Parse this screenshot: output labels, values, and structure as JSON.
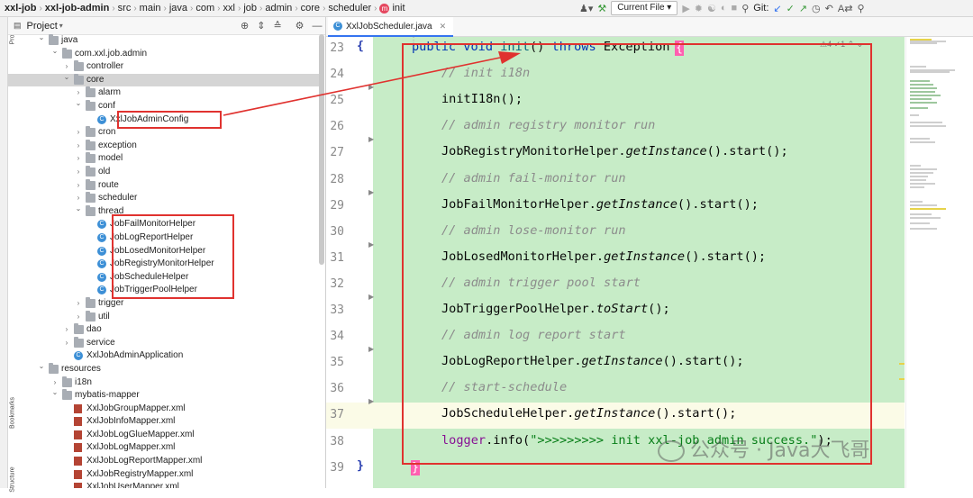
{
  "breadcrumbs": [
    "xxl-job",
    "xxl-job-admin",
    "src",
    "main",
    "java",
    "com",
    "xxl",
    "job",
    "admin",
    "core",
    "scheduler",
    "init"
  ],
  "toolbar": {
    "run_config": "Current File",
    "git_label": "Git:"
  },
  "stripe": {
    "project": "Project",
    "bookmarks": "Bookmarks",
    "structure": "Structure"
  },
  "project_panel": {
    "title": "Project"
  },
  "tree": [
    {
      "label": "java",
      "type": "folder",
      "depth": 0,
      "open": true
    },
    {
      "label": "com.xxl.job.admin",
      "type": "folder",
      "depth": 1,
      "open": true
    },
    {
      "label": "controller",
      "type": "folder",
      "depth": 2,
      "open": false
    },
    {
      "label": "core",
      "type": "folder",
      "depth": 2,
      "open": true,
      "selected": true
    },
    {
      "label": "alarm",
      "type": "folder",
      "depth": 3,
      "open": false
    },
    {
      "label": "conf",
      "type": "folder",
      "depth": 3,
      "open": true
    },
    {
      "label": "XxlJobAdminConfig",
      "type": "class",
      "depth": 4
    },
    {
      "label": "cron",
      "type": "folder",
      "depth": 3,
      "open": false
    },
    {
      "label": "exception",
      "type": "folder",
      "depth": 3,
      "open": false
    },
    {
      "label": "model",
      "type": "folder",
      "depth": 3,
      "open": false
    },
    {
      "label": "old",
      "type": "folder",
      "depth": 3,
      "open": false
    },
    {
      "label": "route",
      "type": "folder",
      "depth": 3,
      "open": false
    },
    {
      "label": "scheduler",
      "type": "folder",
      "depth": 3,
      "open": false
    },
    {
      "label": "thread",
      "type": "folder",
      "depth": 3,
      "open": true
    },
    {
      "label": "JobFailMonitorHelper",
      "type": "class",
      "depth": 4
    },
    {
      "label": "JobLogReportHelper",
      "type": "class",
      "depth": 4
    },
    {
      "label": "JobLosedMonitorHelper",
      "type": "class",
      "depth": 4
    },
    {
      "label": "JobRegistryMonitorHelper",
      "type": "class",
      "depth": 4
    },
    {
      "label": "JobScheduleHelper",
      "type": "class",
      "depth": 4
    },
    {
      "label": "JobTriggerPoolHelper",
      "type": "class",
      "depth": 4
    },
    {
      "label": "trigger",
      "type": "folder",
      "depth": 3,
      "open": false
    },
    {
      "label": "util",
      "type": "folder",
      "depth": 3,
      "open": false
    },
    {
      "label": "dao",
      "type": "folder",
      "depth": 2,
      "open": false
    },
    {
      "label": "service",
      "type": "folder",
      "depth": 2,
      "open": false
    },
    {
      "label": "XxlJobAdminApplication",
      "type": "class",
      "depth": 2
    },
    {
      "label": "resources",
      "type": "folder",
      "depth": 0,
      "open": true
    },
    {
      "label": "i18n",
      "type": "folder",
      "depth": 1,
      "open": false
    },
    {
      "label": "mybatis-mapper",
      "type": "folder",
      "depth": 1,
      "open": true
    },
    {
      "label": "XxlJobGroupMapper.xml",
      "type": "xml",
      "depth": 2
    },
    {
      "label": "XxlJobInfoMapper.xml",
      "type": "xml",
      "depth": 2
    },
    {
      "label": "XxlJobLogGlueMapper.xml",
      "type": "xml",
      "depth": 2
    },
    {
      "label": "XxlJobLogMapper.xml",
      "type": "xml",
      "depth": 2
    },
    {
      "label": "XxlJobLogReportMapper.xml",
      "type": "xml",
      "depth": 2
    },
    {
      "label": "XxlJobRegistryMapper.xml",
      "type": "xml",
      "depth": 2
    },
    {
      "label": "XxlJobUserMapper.xml",
      "type": "xml",
      "depth": 2
    }
  ],
  "editor": {
    "tab": "XxlJobScheduler.java",
    "inspection": "⚠4 ✓1",
    "lines": [
      {
        "n": "23",
        "brace": "{",
        "hl": false
      },
      {
        "n": "24",
        "hl": false
      },
      {
        "n": "25",
        "hl": false
      },
      {
        "n": "26",
        "hl": false
      },
      {
        "n": "27",
        "hl": false
      },
      {
        "n": "28",
        "hl": false
      },
      {
        "n": "29",
        "hl": false
      },
      {
        "n": "30",
        "hl": false
      },
      {
        "n": "31",
        "hl": false
      },
      {
        "n": "32",
        "hl": false
      },
      {
        "n": "33",
        "hl": false
      },
      {
        "n": "34",
        "hl": false
      },
      {
        "n": "35",
        "hl": false
      },
      {
        "n": "36",
        "hl": false
      },
      {
        "n": "37",
        "hl": true
      },
      {
        "n": "38",
        "hl": false
      },
      {
        "n": "39",
        "brace": "}",
        "hl": false
      }
    ],
    "code": {
      "l23": {
        "kw1": "public void ",
        "name": "init",
        "rest": "() ",
        "kw2": "throws ",
        "exc": "Exception "
      },
      "l24": "// init i18n",
      "l25": {
        "call": "initI18n",
        "rest": "();"
      },
      "l26": "// admin registry monitor run",
      "l27": {
        "cls": "JobRegistryMonitorHelper.",
        "m": "getInstance",
        "rest": "().start();"
      },
      "l28": "// admin fail-monitor run",
      "l29": {
        "cls": "JobFailMonitorHelper.",
        "m": "getInstance",
        "rest": "().start();"
      },
      "l30": "// admin lose-monitor run",
      "l31": {
        "cls": "JobLosedMonitorHelper.",
        "m": "getInstance",
        "rest": "().start();"
      },
      "l32": "// admin trigger pool start",
      "l33": {
        "cls": "JobTriggerPoolHelper.",
        "m": "toStart",
        "rest": "();"
      },
      "l34": "// admin log report start",
      "l35": {
        "cls": "JobLogReportHelper.",
        "m": "getInstance",
        "rest": "().start();"
      },
      "l36": "// start-schedule",
      "l37": {
        "cls": "JobScheduleHelper.",
        "m": "getInstance",
        "rest": "().start();"
      },
      "l38": {
        "field": "logger",
        "call": ".info(",
        "str": "\">>>>>>>>> init xxl-job admin success.\"",
        "rest": ");"
      }
    }
  },
  "watermark": "公众号 · Java大飞哥",
  "colors": {
    "annotation_red": "#e0322f",
    "code_bg": "#c7ecc7",
    "keyword": "#0033b3"
  }
}
